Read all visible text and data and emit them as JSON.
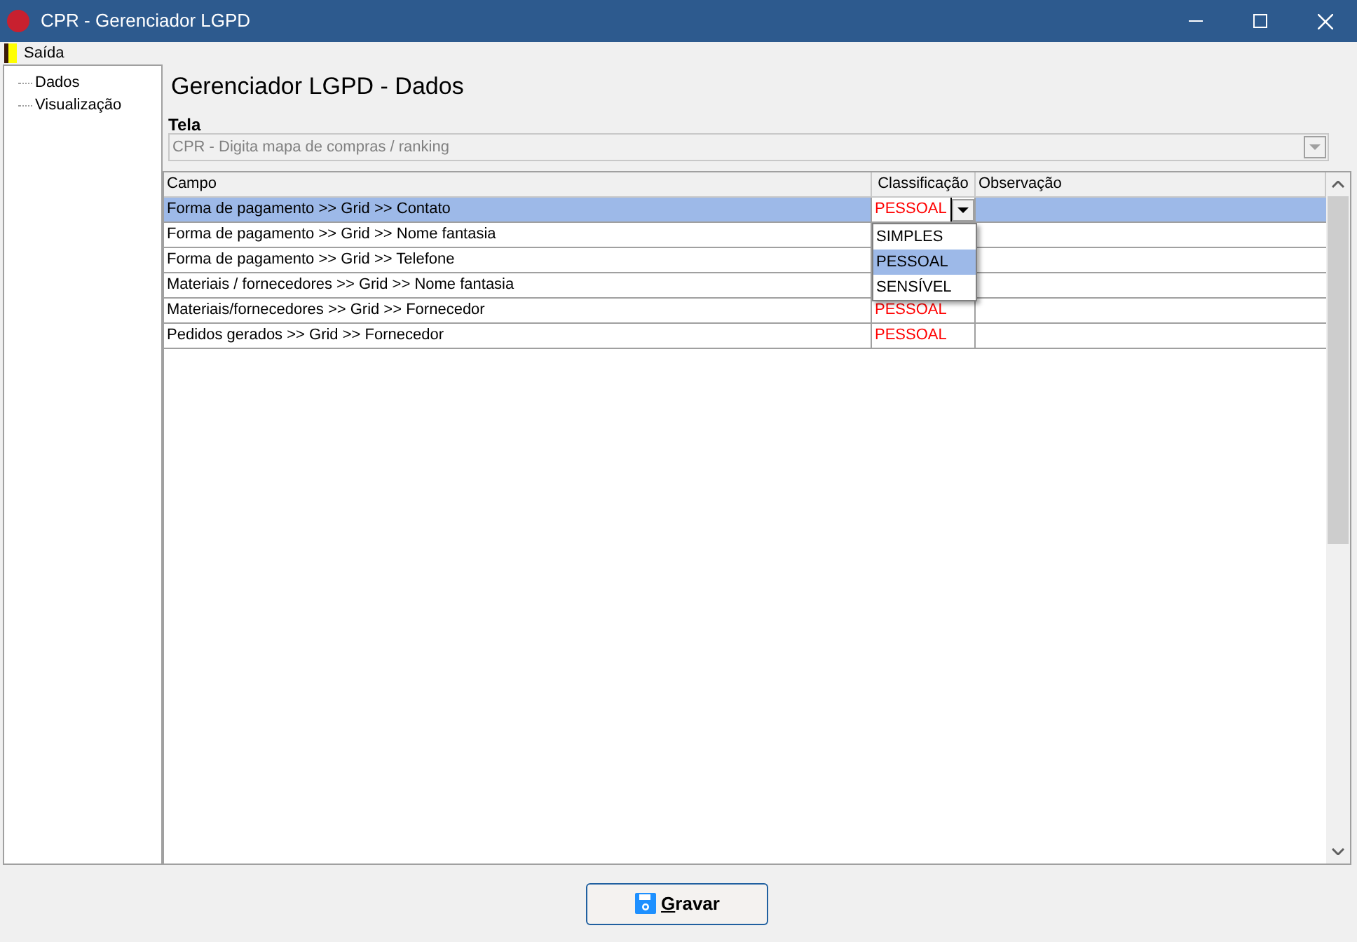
{
  "window": {
    "title": "CPR - Gerenciador LGPD"
  },
  "menu": [
    {
      "label": "Saída"
    }
  ],
  "tree": {
    "items": [
      {
        "label": "Dados"
      },
      {
        "label": "Visualização"
      }
    ]
  },
  "heading": "Gerenciador LGPD - Dados",
  "tela": {
    "label": "Tela",
    "value": "CPR - Digita mapa de compras / ranking",
    "disabled": true
  },
  "table": {
    "columns": [
      "Campo",
      "Classificação",
      "Observação"
    ],
    "rows": [
      {
        "campo": "Forma de pagamento >> Grid >> Contato",
        "classificacao": "PESSOAL",
        "selected": true,
        "editing": true
      },
      {
        "campo": "Forma de pagamento >> Grid >> Nome fantasia",
        "selected": false,
        "editing": false
      },
      {
        "campo": "Forma de pagamento >> Grid >> Telefone",
        "selected": false,
        "editing": false
      },
      {
        "campo": "Materiais / fornecedores >> Grid >> Nome fantasia",
        "selected": false,
        "editing": false
      },
      {
        "campo": "Materiais/fornecedores >> Grid >> Fornecedor",
        "classificacao": "PESSOAL",
        "selected": false,
        "editing": false
      },
      {
        "campo": "Pedidos gerados >> Grid >> Fornecedor",
        "classificacao": "PESSOAL",
        "selected": false,
        "editing": false
      }
    ],
    "dropdown": [
      {
        "label": "SIMPLES",
        "selected": false
      },
      {
        "label": "PESSOAL",
        "selected": true
      },
      {
        "label": "SENSÍVEL",
        "selected": false
      }
    ]
  },
  "button": {
    "label": "Gravar"
  }
}
